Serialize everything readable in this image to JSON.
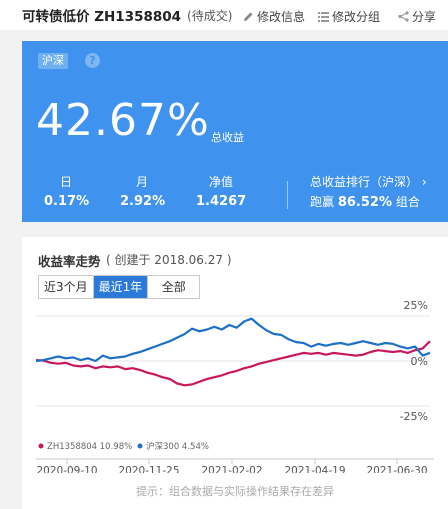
{
  "header": {
    "title": "可转债低价 ZH1358804",
    "status": "(待成交)",
    "edit_label": "修改信息",
    "group_label": "修改分组",
    "share_label": "分享"
  },
  "summary": {
    "market_badge": "沪深",
    "help_icon": "?",
    "total_return": "42.67%",
    "total_return_label": "总收益",
    "stats": [
      {
        "label": "日",
        "value": "0.17%"
      },
      {
        "label": "月",
        "value": "2.92%"
      },
      {
        "label": "净值",
        "value": "1.4267"
      }
    ],
    "rank_label": "总收益排行（沪深）",
    "rank_prefix": "跑赢",
    "rank_value": "86.52%",
    "rank_suffix": "组合",
    "colors": {
      "card": "#3f93ee"
    }
  },
  "chart_panel": {
    "title": "收益率走势",
    "subtitle": "( 创建于 2018.06.27 )",
    "tabs": [
      "近3个月",
      "最近1年",
      "全部"
    ],
    "active_tab": 1,
    "footnote": "提示：组合数据与实际操作结果存在差异"
  },
  "chart_data": {
    "type": "line",
    "y_tick_labels": [
      "25%",
      "0%",
      "-25%"
    ],
    "ylim": [
      -25,
      25
    ],
    "x_tick_labels": [
      "2020-09-10",
      "2020-11-25",
      "2021-02-02",
      "2021-04-19",
      "2021-06-30"
    ],
    "legend": [
      {
        "label": "ZH1358804 10.98%",
        "color": "#c8185a"
      },
      {
        "label": "沪深300 4.54%",
        "color": "#1e6fc8"
      }
    ],
    "series": [
      {
        "name": "ZH1358804",
        "color": "#c8185a",
        "values": [
          0.5,
          0.2,
          -1.0,
          -1.5,
          -1.0,
          -2.5,
          -3.0,
          -2.5,
          -4.0,
          -3.0,
          -3.5,
          -3.0,
          -4.5,
          -4.0,
          -5.0,
          -6.5,
          -7.5,
          -9.0,
          -10.0,
          -12.5,
          -13.5,
          -13.0,
          -11.5,
          -10.0,
          -9.0,
          -8.0,
          -6.5,
          -5.5,
          -4.0,
          -3.0,
          -1.5,
          -0.5,
          0.5,
          1.5,
          2.5,
          3.5,
          4.5,
          4.0,
          4.5,
          3.5,
          4.5,
          4.0,
          3.5,
          3.0,
          3.5,
          5.0,
          6.0,
          5.5,
          5.0,
          5.5,
          4.5,
          6.0,
          7.0,
          10.98
        ]
      },
      {
        "name": "沪深300",
        "color": "#1e6fc8",
        "values": [
          0.0,
          0.5,
          1.5,
          2.5,
          1.5,
          2.0,
          0.5,
          1.5,
          0.0,
          3.0,
          1.5,
          2.0,
          2.5,
          4.0,
          5.0,
          6.5,
          8.0,
          9.5,
          11.0,
          13.0,
          15.0,
          18.0,
          16.5,
          17.5,
          19.0,
          17.5,
          20.0,
          18.5,
          22.0,
          23.5,
          20.0,
          17.0,
          15.0,
          14.5,
          12.0,
          10.5,
          10.0,
          8.0,
          9.5,
          8.5,
          9.5,
          10.0,
          9.0,
          10.0,
          11.0,
          10.0,
          9.0,
          10.0,
          9.5,
          8.0,
          7.0,
          8.0,
          3.0,
          4.54
        ]
      }
    ]
  }
}
